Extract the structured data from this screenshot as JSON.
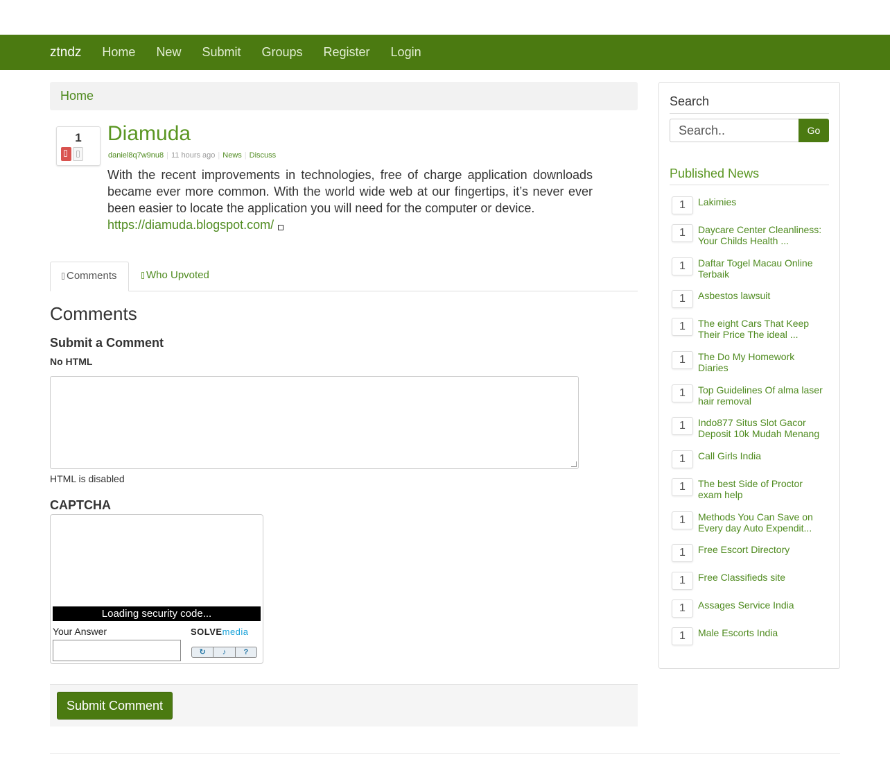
{
  "nav": {
    "brand": "ztndz",
    "links": [
      "Home",
      "New",
      "Submit",
      "Groups",
      "Register",
      "Login"
    ]
  },
  "breadcrumb": {
    "home": "Home"
  },
  "story": {
    "votes": "1",
    "title": "Diamuda",
    "author": "daniel8q7w9nu8",
    "time": "11 hours ago",
    "category": "News",
    "discuss": "Discuss",
    "body": "With the recent improvements in technologies, free of charge application downloads became ever more common. With the world wide web at our fingertips, it’s never ever been easier to locate the application you will need for the computer or device.",
    "url": "https://diamuda.blogspot.com/"
  },
  "tabs": {
    "comments": "Comments",
    "who_upvoted": "Who Upvoted"
  },
  "comments": {
    "heading": "Comments",
    "submit_heading": "Submit a Comment",
    "no_html": "No HTML",
    "html_disabled": "HTML is disabled",
    "captcha_heading": "CAPTCHA",
    "captcha_loading": "Loading security code...",
    "captcha_answer_label": "Your Answer",
    "captcha_brand_a": "SOLVE",
    "captcha_brand_b": "media",
    "submit_button": "Submit Comment"
  },
  "sidebar": {
    "search_title": "Search",
    "search_placeholder": "Search..",
    "search_button": "Go",
    "published_title": "Published News",
    "items": [
      {
        "count": "1",
        "title": "Lakimies"
      },
      {
        "count": "1",
        "title": "Daycare Center Cleanliness: Your Childs Health ..."
      },
      {
        "count": "1",
        "title": "Daftar Togel Macau Online Terbaik"
      },
      {
        "count": "1",
        "title": "Asbestos lawsuit"
      },
      {
        "count": "1",
        "title": "The eight Cars That Keep Their Price The ideal ..."
      },
      {
        "count": "1",
        "title": "The Do My Homework Diaries"
      },
      {
        "count": "1",
        "title": "Top Guidelines Of alma laser hair removal"
      },
      {
        "count": "1",
        "title": "Indo877 Situs Slot Gacor Deposit 10k Mudah Menang"
      },
      {
        "count": "1",
        "title": "Call Girls India"
      },
      {
        "count": "1",
        "title": "The best Side of Proctor exam help"
      },
      {
        "count": "1",
        "title": "Methods You Can Save on Every day Auto Expendit..."
      },
      {
        "count": "1",
        "title": "Free Escort Directory"
      },
      {
        "count": "1",
        "title": "Free Classifieds site"
      },
      {
        "count": "1",
        "title": "Assages Service India"
      },
      {
        "count": "1",
        "title": "Male Escorts India"
      }
    ]
  },
  "colors": {
    "navbar": "#4b7a11",
    "link": "#4e8a1e",
    "vote_down": "#d9534f"
  }
}
